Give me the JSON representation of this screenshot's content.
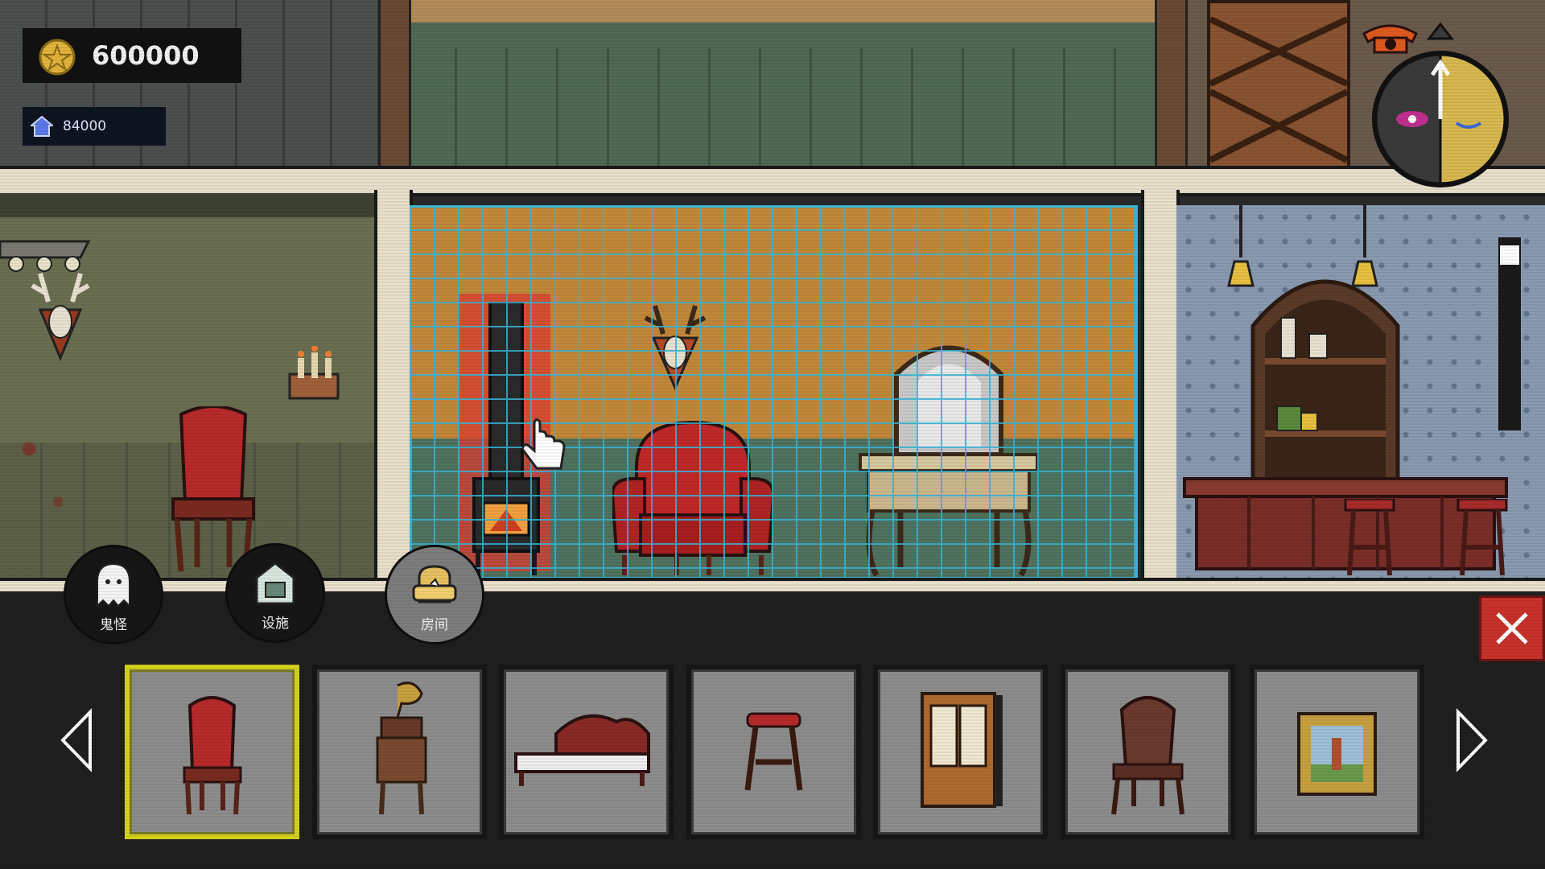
{
  "hud": {
    "coins": "600000",
    "house_value": "84000",
    "coin_icon": "pentagram-coin-icon",
    "house_icon": "house-icon"
  },
  "categories": [
    {
      "label": "鬼怪",
      "icon": "ghost-icon"
    },
    {
      "label": "设施",
      "icon": "facility-icon"
    },
    {
      "label": "房间",
      "icon": "room-furniture-icon"
    }
  ],
  "active_category": "房间",
  "items": [
    {
      "icon": "ornate-chair-icon",
      "selected": true
    },
    {
      "icon": "gramophone-stand-icon",
      "selected": false
    },
    {
      "icon": "ornate-bed-icon",
      "selected": false
    },
    {
      "icon": "bar-stool-icon",
      "selected": false
    },
    {
      "icon": "cabinet-icon",
      "selected": false
    },
    {
      "icon": "wooden-chair-icon",
      "selected": false
    },
    {
      "icon": "framed-painting-icon",
      "selected": false
    }
  ],
  "colors": {
    "selected_border": "#d7d21c",
    "close_button": "#c8322b",
    "grid_line": "#38b6d8",
    "slot_bg": "#8d8d8d"
  }
}
